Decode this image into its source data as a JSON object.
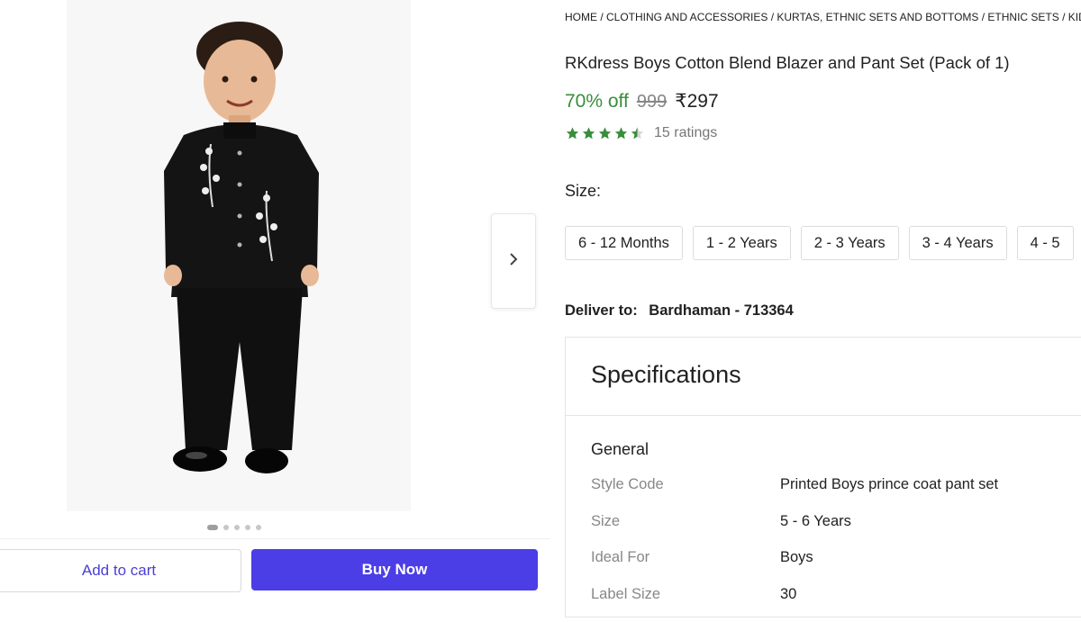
{
  "breadcrumb": "HOME / CLOTHING AND ACCESSORIES / KURTAS, ETHNIC SETS AND BOTTOMS / ETHNIC SETS / KIDS",
  "product": {
    "title": "RKdress Boys Cotton Blend Blazer and Pant Set (Pack of 1)",
    "discount": "70% off",
    "mrp": "999",
    "price": "₹297",
    "rating_stars": 4.5,
    "ratings_count": "15 ratings"
  },
  "size": {
    "label": "Size:",
    "options": [
      "6 - 12 Months",
      "1 - 2 Years",
      "2 - 3 Years",
      "3 - 4 Years",
      "4 - 5"
    ]
  },
  "delivery": {
    "label": "Deliver to:",
    "location": "Bardhaman - 713364"
  },
  "specifications": {
    "title": "Specifications",
    "section": "General",
    "rows": [
      {
        "key": "Style Code",
        "value": "Printed Boys prince coat pant set"
      },
      {
        "key": "Size",
        "value": "5 - 6 Years"
      },
      {
        "key": "Ideal For",
        "value": "Boys"
      },
      {
        "key": "Label Size",
        "value": "30"
      }
    ]
  },
  "gallery": {
    "image_count": 5,
    "active_index": 0
  },
  "actions": {
    "add_to_cart": "Add to cart",
    "buy_now": "Buy Now"
  },
  "colors": {
    "discount_green": "#388e3c",
    "buy_button": "#4b3ee6",
    "star_green": "#388e3c"
  },
  "icons": {
    "next": "chevron-right-icon",
    "star": "star-icon"
  }
}
